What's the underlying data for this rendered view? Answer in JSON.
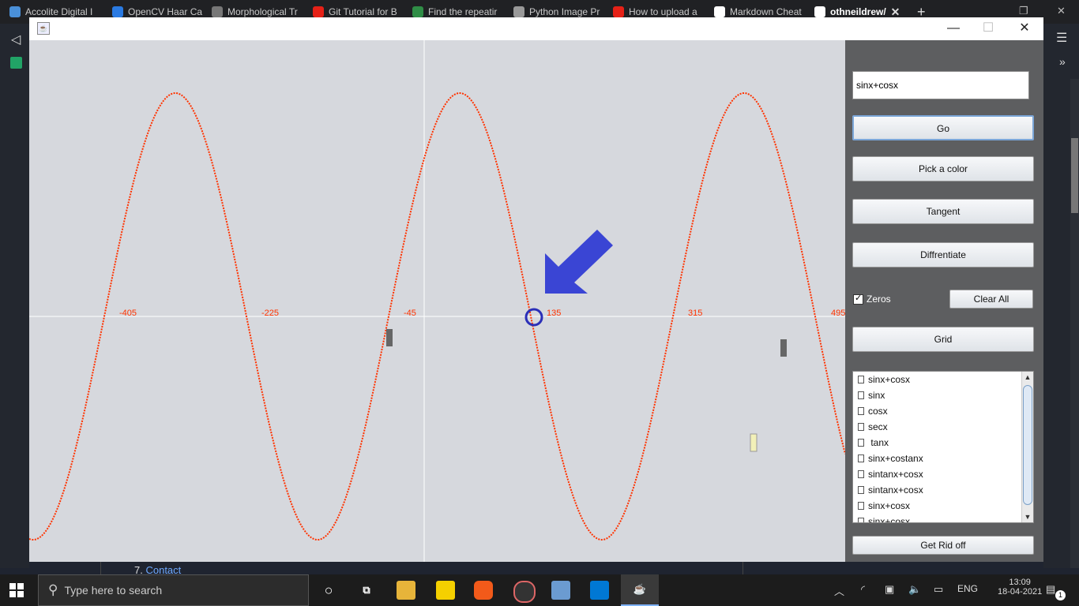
{
  "browser": {
    "tabs": [
      {
        "label": "Accolite Digital I",
        "icon": "accolite-icon",
        "color": "#4a90d9"
      },
      {
        "label": "OpenCV Haar Ca",
        "icon": "pyimagesearch-icon",
        "color": "#2a7ae2"
      },
      {
        "label": "Morphological Tr",
        "icon": "page-icon",
        "color": "#777777"
      },
      {
        "label": "Git Tutorial for B",
        "icon": "youtube-icon",
        "color": "#e62117"
      },
      {
        "label": "Find the repeatir",
        "icon": "gfg-icon",
        "color": "#2f8d46"
      },
      {
        "label": "Python Image Pr",
        "icon": "site-icon",
        "color": "#999999"
      },
      {
        "label": "How to upload a",
        "icon": "youtube-icon",
        "color": "#e62117"
      },
      {
        "label": "Markdown Cheat",
        "icon": "github-icon",
        "color": "#ffffff"
      },
      {
        "label": "othneildrew/",
        "icon": "github-icon",
        "color": "#ffffff",
        "active": true
      }
    ],
    "new_tab": "+"
  },
  "background_page": {
    "item_number": "7.",
    "item_link": "Contact"
  },
  "window": {
    "minimize": "—",
    "maximize": "☐",
    "close": "✕"
  },
  "plot": {
    "function": "sinx+cosx",
    "curve_color": "#ff3300",
    "axis_color": "#ffffff",
    "background": "#d6d8dd",
    "tick_labels": [
      "-405",
      "-225",
      "-45",
      "135",
      "315",
      "495"
    ],
    "zero_marker_color": "#2b2fb8",
    "arrow_color": "#3a45d4"
  },
  "panel": {
    "function_input_value": "sinx+cosx",
    "go_label": "Go",
    "pick_color_label": "Pick a color",
    "tangent_label": "Tangent",
    "differentiate_label": "Diffrentiate",
    "zeros_label": "Zeros",
    "zeros_checked": true,
    "clear_all_label": "Clear All",
    "grid_label": "Grid",
    "function_list": [
      "sinx+cosx",
      "sinx",
      "cosx",
      "secx",
      " tanx",
      "sinx+costanx",
      "sintanx+cosx",
      "sintanx+cosx",
      "sinx+cosx",
      "sinx+cosx"
    ],
    "get_rid_off_label": "Get Rid off"
  },
  "taskbar": {
    "search_placeholder": "Type here to search",
    "language": "ENG",
    "time": "13:09",
    "date": "18-04-2021",
    "notification_count": "1"
  }
}
